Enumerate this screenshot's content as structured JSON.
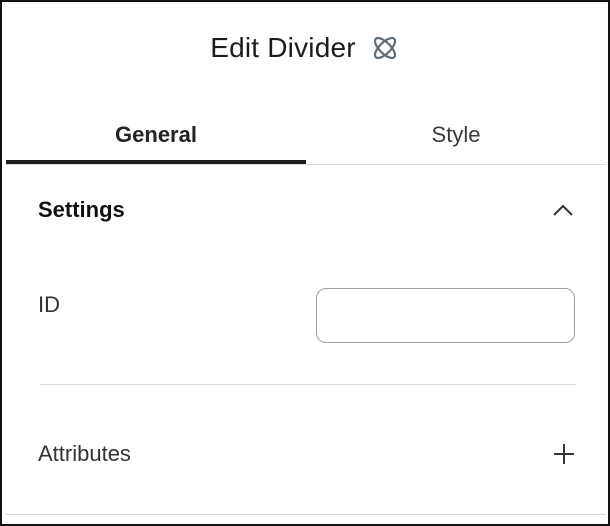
{
  "header": {
    "title": "Edit Divider",
    "icon": "atom-icon"
  },
  "tabs": [
    {
      "label": "General",
      "active": true
    },
    {
      "label": "Style",
      "active": false
    }
  ],
  "settings": {
    "title": "Settings",
    "toggle_icon": "chevron-up-icon",
    "id_field": {
      "label": "ID",
      "value": "",
      "placeholder": ""
    }
  },
  "attributes": {
    "label": "Attributes",
    "add_icon": "plus-icon"
  },
  "colors": {
    "accent": "#1f1f1f",
    "border": "#d9d9d9",
    "icon": "#5f6b75"
  }
}
